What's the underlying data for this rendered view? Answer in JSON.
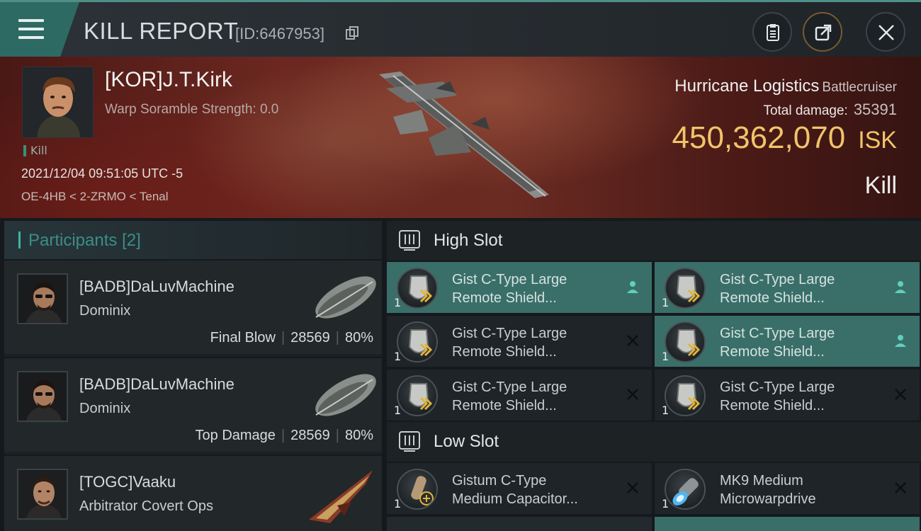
{
  "header": {
    "title": "KILL REPORT",
    "report_id": "[ID:6467953]"
  },
  "victim": {
    "name": "[KOR]J.T.Kirk",
    "warp_scramble": "Warp Soramble Strength: 0.0",
    "type_tag": "Kill",
    "timestamp": "2021/12/04 09:51:05 UTC -5",
    "location": "OE-4HB < 2-ZRMO < Tenal",
    "ship_name": "Hurricane Logistics",
    "ship_class": "Battlecruiser",
    "total_damage_label": "Total damage:",
    "total_damage": "35391",
    "isk_value": "450,362,070",
    "isk_unit": "ISK",
    "result": "Kill"
  },
  "participants": {
    "title": "Participants",
    "count": "[2]",
    "rows": [
      {
        "name": "[BADB]DaLuvMachine",
        "ship": "Dominix",
        "role": "Final Blow",
        "damage": "28569",
        "percent": "80%"
      },
      {
        "name": "[BADB]DaLuvMachine",
        "ship": "Dominix",
        "role": "Top Damage",
        "damage": "28569",
        "percent": "80%"
      },
      {
        "name": "[TOGC]Vaaku",
        "ship": "Arbitrator Covert Ops"
      }
    ]
  },
  "slots": {
    "high": {
      "title": "High Slot",
      "modules": [
        {
          "line1": "Gist C-Type Large",
          "line2": "Remote Shield...",
          "qty": "1",
          "status": "person-icon"
        },
        {
          "line1": "Gist C-Type Large",
          "line2": "Remote Shield...",
          "qty": "1",
          "status": "person-icon"
        },
        {
          "line1": "Gist C-Type Large",
          "line2": "Remote Shield...",
          "qty": "1",
          "status": "destroyed-icon"
        },
        {
          "line1": "Gist C-Type Large",
          "line2": "Remote Shield...",
          "qty": "1",
          "status": "person-icon"
        },
        {
          "line1": "Gist C-Type Large",
          "line2": "Remote Shield...",
          "qty": "1",
          "status": "destroyed-icon"
        },
        {
          "line1": "Gist C-Type Large",
          "line2": "Remote Shield...",
          "qty": "1",
          "status": "destroyed-icon"
        }
      ]
    },
    "low": {
      "title": "Low Slot",
      "modules": [
        {
          "line1": "Gistum C-Type",
          "line2": "Medium Capacitor...",
          "qty": "1",
          "status": "destroyed-icon"
        },
        {
          "line1": "MK9 Medium",
          "line2": "Microwarpdrive",
          "qty": "1",
          "status": "destroyed-icon"
        }
      ]
    }
  },
  "colors": {
    "accent": "#3cb7a4",
    "highlight_row": "#3a6f69",
    "isk": "#f1c46a"
  }
}
